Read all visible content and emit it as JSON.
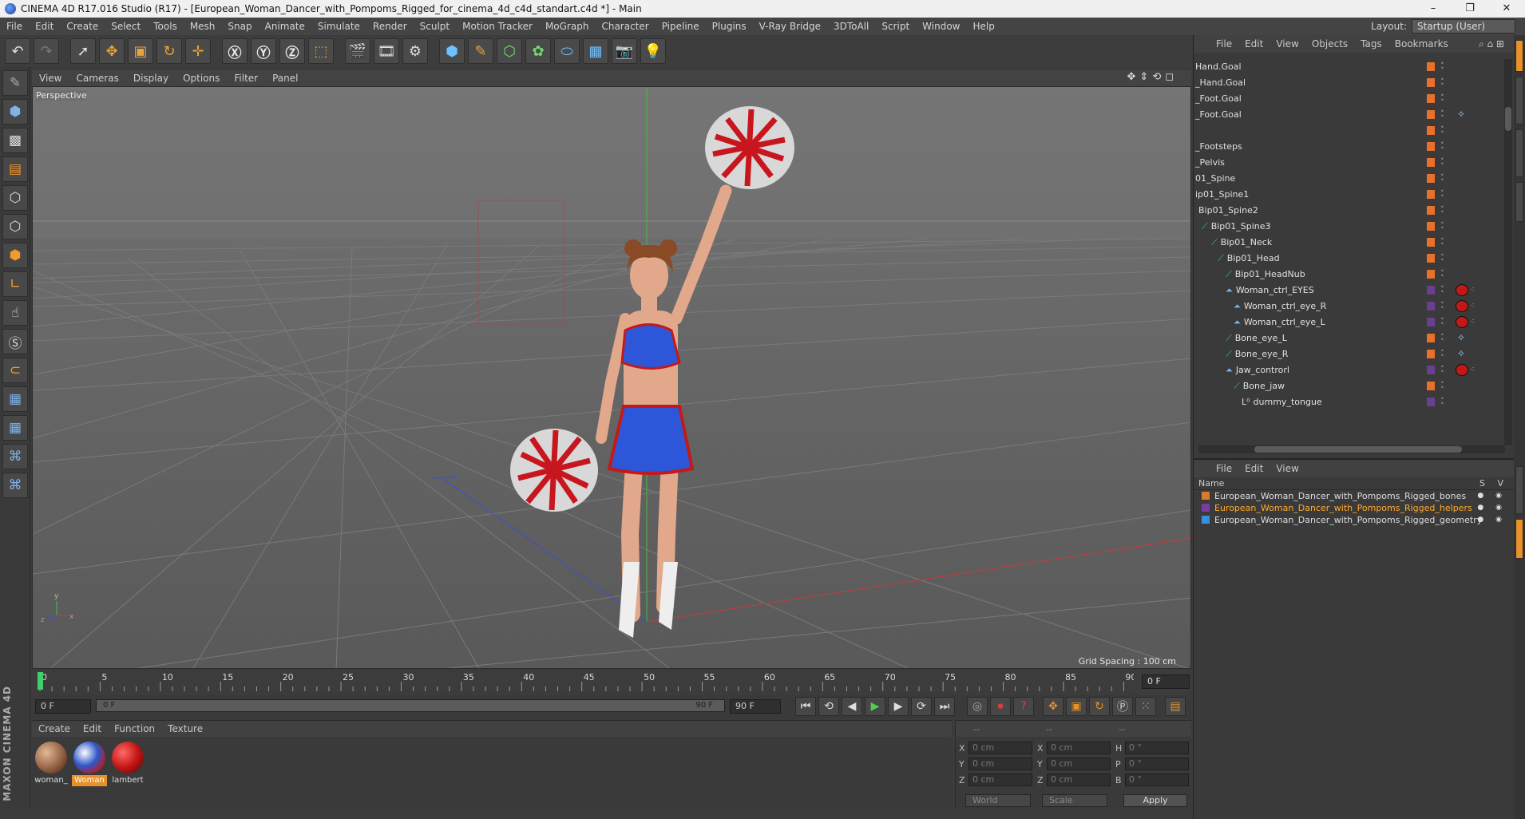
{
  "window": {
    "title": "CINEMA 4D R17.016 Studio (R17) - [European_Woman_Dancer_with_Pompoms_Rigged_for_cinema_4d_c4d_standart.c4d *] - Main",
    "controls": [
      "–",
      "❐",
      "✕"
    ]
  },
  "menubar": {
    "items": [
      "File",
      "Edit",
      "Create",
      "Select",
      "Tools",
      "Mesh",
      "Snap",
      "Animate",
      "Simulate",
      "Render",
      "Sculpt",
      "Motion Tracker",
      "MoGraph",
      "Character",
      "Pipeline",
      "Plugins",
      "V-Ray Bridge",
      "3DToAll",
      "Script",
      "Window",
      "Help"
    ],
    "layout_label": "Layout:",
    "layout_value": "Startup (User)"
  },
  "viewport": {
    "menu": [
      "View",
      "Cameras",
      "Display",
      "Options",
      "Filter",
      "Panel"
    ],
    "label": "Perspective",
    "grid_spacing": "Grid Spacing : 100 cm",
    "axis_labels": {
      "x": "x",
      "y": "y",
      "z": "z"
    }
  },
  "timeline": {
    "ticks": [
      "0",
      "5",
      "10",
      "15",
      "20",
      "25",
      "30",
      "35",
      "40",
      "45",
      "50",
      "55",
      "60",
      "65",
      "70",
      "75",
      "80",
      "85",
      "90"
    ],
    "current_frame": "0 F",
    "start_frame": "0 F",
    "range_start": "0 F",
    "range_end": "90 F",
    "end_frame": "90 F"
  },
  "materials": {
    "menu": [
      "Create",
      "Edit",
      "Function",
      "Texture"
    ],
    "items": [
      {
        "name": "woman_",
        "color": "#8b5a3c"
      },
      {
        "name": "Woman",
        "color": "#2e56c8"
      },
      {
        "name": "lambert",
        "color": "#c41616"
      }
    ]
  },
  "coordinates": {
    "header": [
      "--",
      "--",
      "--"
    ],
    "rows": [
      {
        "a": "X",
        "av": "0 cm",
        "b": "X",
        "bv": "0 cm",
        "c": "H",
        "cv": "0 °"
      },
      {
        "a": "Y",
        "av": "0 cm",
        "b": "Y",
        "bv": "0 cm",
        "c": "P",
        "cv": "0 °"
      },
      {
        "a": "Z",
        "av": "0 cm",
        "b": "Z",
        "bv": "0 cm",
        "c": "B",
        "cv": "0 °"
      }
    ],
    "mode1": "World",
    "mode2": "Scale",
    "apply": "Apply"
  },
  "objects": {
    "menu": [
      "File",
      "Edit",
      "View",
      "Objects",
      "Tags",
      "Bookmarks"
    ],
    "rows": [
      {
        "label": "Hand.Goal",
        "icon": ""
      },
      {
        "label": "_Hand.Goal",
        "icon": ""
      },
      {
        "label": "_Foot.Goal",
        "icon": ""
      },
      {
        "label": "_Foot.Goal",
        "icon": ""
      },
      {
        "label": "",
        "icon": ""
      },
      {
        "label": "_Footsteps",
        "icon": ""
      },
      {
        "label": "_Pelvis",
        "icon": ""
      },
      {
        "label": "01_Spine",
        "icon": ""
      },
      {
        "label": "ip01_Spine1",
        "icon": ""
      },
      {
        "label": "Bip01_Spine2",
        "icon": ""
      },
      {
        "label": "Bip01_Spine3",
        "icon": "bone"
      },
      {
        "label": "Bip01_Neck",
        "icon": "bone"
      },
      {
        "label": "Bip01_Head",
        "icon": "bone"
      },
      {
        "label": "Bip01_HeadNub",
        "icon": "bone"
      },
      {
        "label": "Woman_ctrl_EYES",
        "icon": "null"
      },
      {
        "label": "Woman_ctrl_eye_R",
        "icon": "null"
      },
      {
        "label": "Woman_ctrl_eye_L",
        "icon": "null"
      },
      {
        "label": "Bone_eye_L",
        "icon": "bone"
      },
      {
        "label": "Bone_eye_R",
        "icon": "bone"
      },
      {
        "label": "Jaw_controrl",
        "icon": "null"
      },
      {
        "label": "Bone_jaw",
        "icon": "bone"
      },
      {
        "label": "dummy_tongue",
        "icon": "dummy"
      }
    ]
  },
  "layers": {
    "menu": [
      "File",
      "Edit",
      "View"
    ],
    "col_name": "Name",
    "col_flags": "S V",
    "rows": [
      {
        "label": "European_Woman_Dancer_with_Pompoms_Rigged_bones",
        "color": "#d77b2d",
        "highlight": false
      },
      {
        "label": "European_Woman_Dancer_with_Pompoms_Rigged_helpers",
        "color": "#7a3ca0",
        "highlight": true
      },
      {
        "label": "European_Woman_Dancer_with_Pompoms_Rigged_geometry",
        "color": "#3b8de0",
        "highlight": false
      }
    ]
  },
  "branding": {
    "logo": "MAXON CINEMA 4D"
  },
  "colors": {
    "accent": "#e8912a",
    "highlight_text": "#ffa92e",
    "tag_red": "#c41818"
  }
}
